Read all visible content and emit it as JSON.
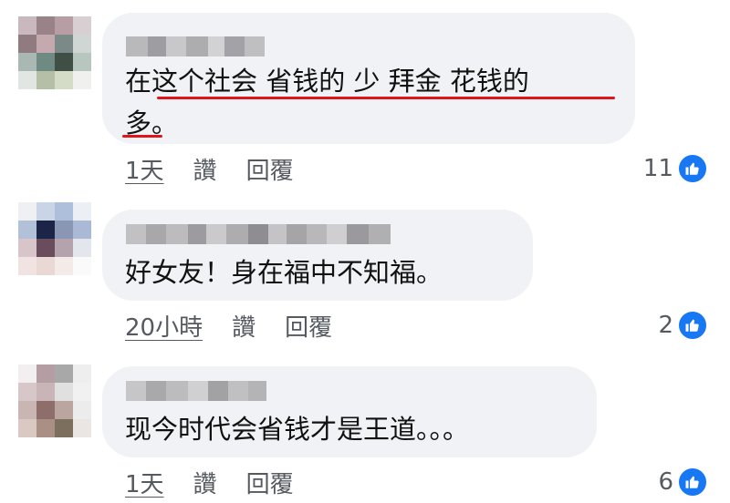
{
  "comments": [
    {
      "text_line1": "在这个社会 省钱的 少 拜金  花钱的",
      "text_line2": "多。",
      "time": "1天",
      "like_label": "讚",
      "reply_label": "回覆",
      "reaction_count": "11",
      "reaction_icon": "like-icon"
    },
    {
      "text_line1": "好女友！身在福中不知福。",
      "time": "20小時",
      "like_label": "讚",
      "reply_label": "回覆",
      "reaction_count": "2",
      "reaction_icon": "like-icon"
    },
    {
      "text_line1": "现今时代会省钱才是王道。。。",
      "time": "1天",
      "like_label": "讚",
      "reply_label": "回覆",
      "reaction_count": "6",
      "reaction_icon": "like-icon"
    }
  ],
  "colors": {
    "bubble": "#f0f2f5",
    "accent_like": "#1877f2",
    "highlight_underline": "#e0141b",
    "meta_text": "#555a61"
  }
}
